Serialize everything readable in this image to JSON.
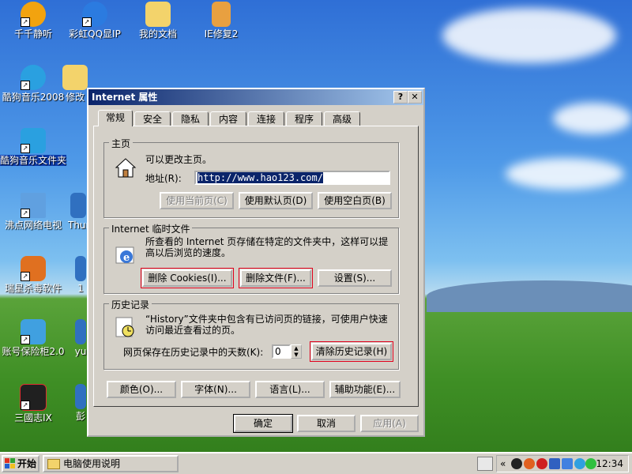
{
  "desktop_icons": [
    {
      "id": "qianqian",
      "label": "千千静听",
      "color": "#f2a30f"
    },
    {
      "id": "caihong",
      "label": "彩虹QQ显IP",
      "color": "#2b7be0"
    },
    {
      "id": "mydocs",
      "label": "我的文档",
      "color": "#f3d36b"
    },
    {
      "id": "iefix",
      "label": "IE修复2",
      "color": "#e8a040"
    },
    {
      "id": "kugou",
      "label": "酷狗音乐2008",
      "color": "#2aa0e0"
    },
    {
      "id": "folder2",
      "label": "修改",
      "color": "#f3d36b"
    },
    {
      "id": "kugoufolder",
      "label": "酷狗音乐文件夹",
      "color": "#2aa0e0"
    },
    {
      "id": "tv",
      "label": "沸点网络电视",
      "color": "#60a0e0"
    },
    {
      "id": "thunder",
      "label": "Thun",
      "color": "#3070c0"
    },
    {
      "id": "rising",
      "label": "瑞星杀毒软件",
      "color": "#e07020"
    },
    {
      "id": "one",
      "label": "1",
      "color": "#3070c0"
    },
    {
      "id": "safe",
      "label": "账号保险柜2.0",
      "color": "#40a0e0"
    },
    {
      "id": "yu",
      "label": "yu",
      "color": "#3070c0"
    },
    {
      "id": "sanguo",
      "label": "三國志IX",
      "color": "#202020"
    },
    {
      "id": "peng",
      "label": "彭",
      "color": "#3070c0"
    }
  ],
  "dialog": {
    "title": "Internet 属性",
    "help_btn": "?",
    "close_btn": "✕",
    "tabs": [
      "常规",
      "安全",
      "隐私",
      "内容",
      "连接",
      "程序",
      "高级"
    ],
    "homepage": {
      "group_label": "主页",
      "desc": "可以更改主页。",
      "address_label": "地址(R):",
      "address_value": "http://www.hao123.com/",
      "btn_current": "使用当前页(C)",
      "btn_default": "使用默认页(D)",
      "btn_blank": "使用空白页(B)"
    },
    "temp_files": {
      "group_label": "Internet 临时文件",
      "desc": "所查看的 Internet 页存储在特定的文件夹中，这样可以提高以后浏览的速度。",
      "btn_cookies": "删除 Cookies(I)...",
      "btn_files": "删除文件(F)...",
      "btn_settings": "设置(S)..."
    },
    "history": {
      "group_label": "历史记录",
      "desc": "“History”文件夹中包含有已访问页的链接，可使用户快速访问最近查看过的页。",
      "days_label": "网页保存在历史记录中的天数(K):",
      "days_value": "0",
      "btn_clear": "清除历史记录(H)"
    },
    "bottom_buttons": {
      "colors": "颜色(O)...",
      "fonts": "字体(N)...",
      "languages": "语言(L)...",
      "accessibility": "辅助功能(E)..."
    },
    "ok": "确定",
    "cancel": "取消",
    "apply": "应用(A)"
  },
  "taskbar": {
    "start": "开始",
    "task": "电脑使用说明",
    "chevron": "«",
    "clock": "12:34"
  }
}
